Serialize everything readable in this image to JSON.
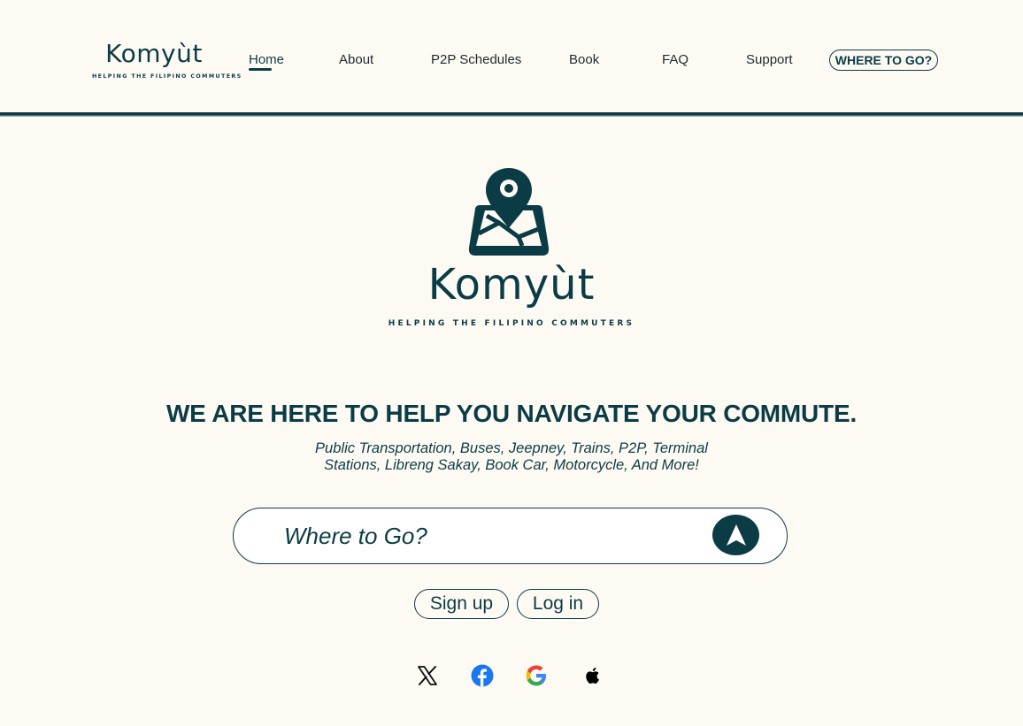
{
  "brand": {
    "name": "Komyùt",
    "tagline": "HELPING THE FILIPINO COMMUTERS"
  },
  "nav": {
    "links": [
      {
        "label": "Home",
        "active": true
      },
      {
        "label": "About"
      },
      {
        "label": "P2P Schedules"
      },
      {
        "label": "Book"
      },
      {
        "label": "FAQ"
      },
      {
        "label": "Support"
      }
    ],
    "cta_label": "WHERE TO GO?"
  },
  "hero": {
    "headline": "WE ARE HERE TO HELP YOU NAVIGATE YOUR COMMUTE.",
    "subline": "Public Transportation, Buses, Jeepney, Trains, P2P, Terminal Stations, Libreng Sakay, Book Car, Motorcycle, And More!"
  },
  "search": {
    "placeholder": "Where to Go?",
    "button_icon": "navigation-arrow-icon"
  },
  "auth": {
    "signup_label": "Sign up",
    "login_label": "Log in"
  },
  "social": [
    {
      "icon": "x-icon"
    },
    {
      "icon": "facebook-icon"
    },
    {
      "icon": "google-icon"
    },
    {
      "icon": "apple-icon"
    }
  ],
  "colors": {
    "brand": "#0b3c45",
    "background": "#fdfaf4",
    "facebook": "#1877f2"
  }
}
